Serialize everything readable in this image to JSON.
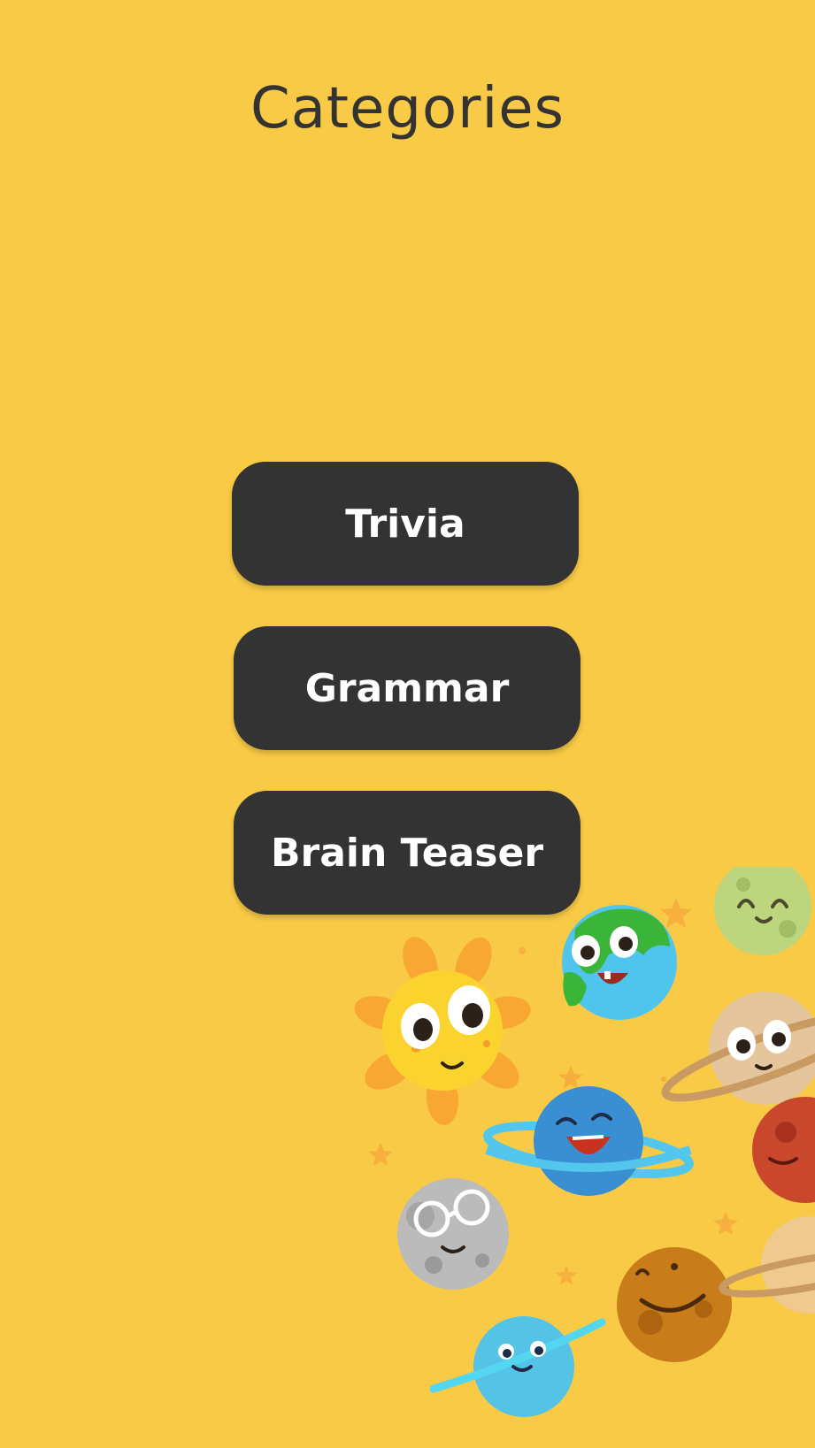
{
  "header": {
    "title": "Categories"
  },
  "categories": [
    {
      "label": "Trivia"
    },
    {
      "label": "Grammar"
    },
    {
      "label": "Brain Teaser"
    }
  ],
  "colors": {
    "background": "#f8ca45",
    "button": "#333333",
    "button_text": "#ffffff",
    "title_text": "#333333"
  },
  "decoration": {
    "illustration": "cartoon-planets-illustration"
  }
}
